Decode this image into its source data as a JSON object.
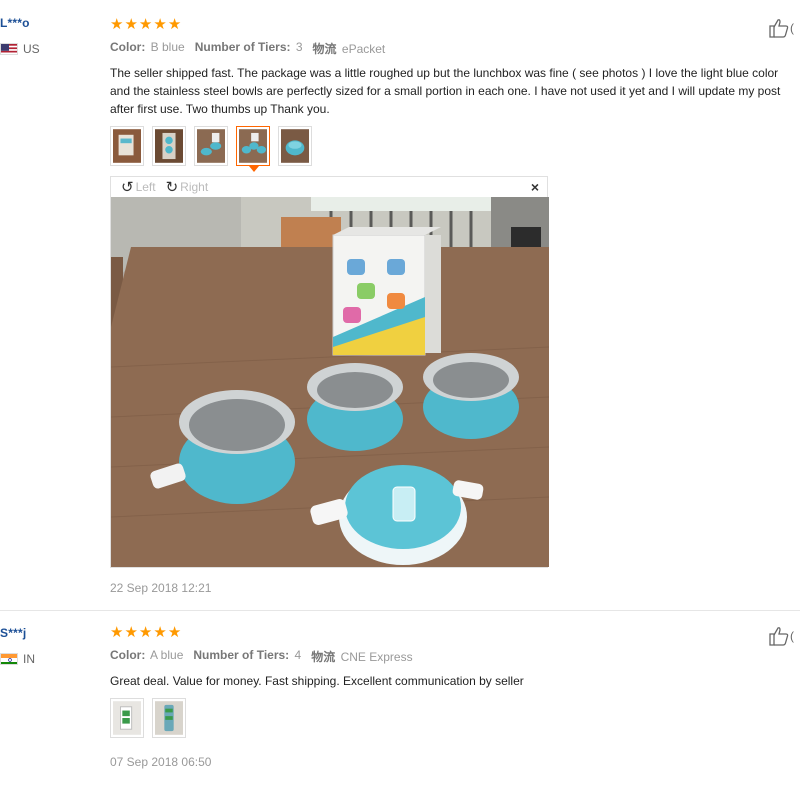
{
  "reviews": [
    {
      "user": "L***o",
      "country": "US",
      "rating_stars": [
        "★",
        "★",
        "★",
        "★",
        "★"
      ],
      "attr_color_key": "Color:",
      "attr_color_val": "B blue",
      "attr_tiers_key": "Number of Tiers:",
      "attr_tiers_val": "3",
      "attr_ship_key": "物流",
      "attr_ship_val": "ePacket",
      "text": "The seller shipped fast. The package was a little roughed up but the lunchbox was fine ( see photos ) I love the light blue color and the stainless steel bowls are perfectly sized for a small portion in each one. I have not used it yet and I will update my post after first use. Two thumbs up Thank you.",
      "viewer_left": "Left",
      "viewer_right": "Right",
      "viewer_close": "×",
      "date": "22 Sep 2018 12:21",
      "helpful": "(",
      "thumb_icon": "thumbs-up-icon"
    },
    {
      "user": "S***j",
      "country": "IN",
      "rating_stars": [
        "★",
        "★",
        "★",
        "★",
        "★"
      ],
      "attr_color_key": "Color:",
      "attr_color_val": "A blue",
      "attr_tiers_key": "Number of Tiers:",
      "attr_tiers_val": "4",
      "attr_ship_key": "物流",
      "attr_ship_val": "CNE Express",
      "text": "Great deal. Value for money. Fast shipping. Excellent communication by seller",
      "date": "07 Sep 2018 06:50",
      "helpful": "(",
      "thumb_icon": "thumbs-up-icon"
    }
  ],
  "colors": {
    "star": "#ff9900",
    "user": "#1c4f96",
    "active_thumb": "#ff6600",
    "lunchbox": "#4fb8cc"
  }
}
